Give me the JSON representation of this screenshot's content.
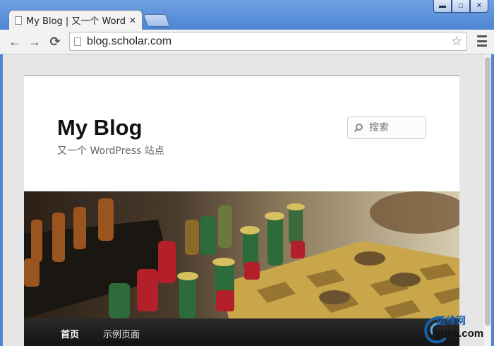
{
  "window": {
    "minimize_glyph": "▬",
    "maximize_glyph": "□",
    "close_glyph": "✕"
  },
  "tab": {
    "title": "My Blog | 又一个 WordPress",
    "close_glyph": "✕"
  },
  "toolbar": {
    "back_glyph": "←",
    "forward_glyph": "→",
    "reload_glyph": "⟳",
    "url": "blog.scholar.com",
    "bookmark_glyph": "☆"
  },
  "site": {
    "title": "My Blog",
    "description": "又一个 WordPress 站点",
    "search": {
      "placeholder": "搜索"
    },
    "nav": [
      {
        "label": "首页",
        "active": true
      },
      {
        "label": "示例页面",
        "active": false
      }
    ]
  },
  "watermark": {
    "line1": "运维网",
    "line2": "iyunv.com"
  },
  "colors": {
    "window_frame": "#4f86d4",
    "nav_bar": "#141414",
    "watermark_blue": "#1a5fa8"
  }
}
